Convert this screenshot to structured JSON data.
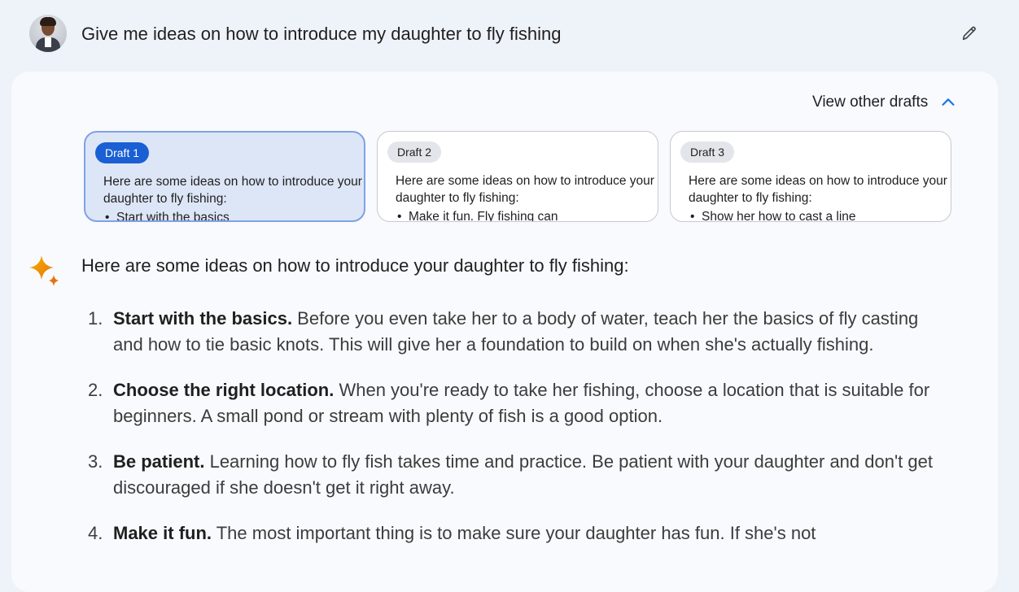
{
  "prompt": {
    "text": "Give me ideas on how to introduce my daughter to fly fishing"
  },
  "drafts_toggle": {
    "label": "View other drafts",
    "icon": "chevron-up-icon"
  },
  "drafts": [
    {
      "label": "Draft 1",
      "selected": true,
      "preview": "Here are some ideas on how to introduce your daughter to fly fishing:",
      "bullet": "Start with the basics"
    },
    {
      "label": "Draft 2",
      "selected": false,
      "preview": "Here are some ideas on how to introduce your daughter to fly fishing:",
      "bullet": "Make it fun. Fly fishing can"
    },
    {
      "label": "Draft 3",
      "selected": false,
      "preview": "Here are some ideas on how to introduce your daughter to fly fishing:",
      "bullet": "Show her how to cast a line"
    }
  ],
  "response": {
    "intro": "Here are some ideas on how to introduce your daughter to fly fishing:",
    "items": [
      {
        "number": "1.",
        "heading": "Start with the basics.",
        "body": " Before you even take her to a body of water, teach her the basics of fly casting and how to tie basic knots. This will give her a foundation to build on when she's actually fishing."
      },
      {
        "number": "2.",
        "heading": "Choose the right location.",
        "body": " When you're ready to take her fishing, choose a location that is suitable for beginners. A small pond or stream with plenty of fish is a good option."
      },
      {
        "number": "3.",
        "heading": "Be patient.",
        "body": " Learning how to fly fish takes time and practice. Be patient with your daughter and don't get discouraged if she doesn't get it right away."
      },
      {
        "number": "4.",
        "heading": "Make it fun.",
        "body": " The most important thing is to make sure your daughter has fun. If she's not"
      }
    ]
  },
  "colors": {
    "page_background": "#eef2f9",
    "card_background": "#f8fafd",
    "selected_pill": "#1a5fd3",
    "selected_draft_bg": "#dde6f7",
    "accent_blue": "#1a73e8",
    "sparkle_orange": "#f29900"
  }
}
